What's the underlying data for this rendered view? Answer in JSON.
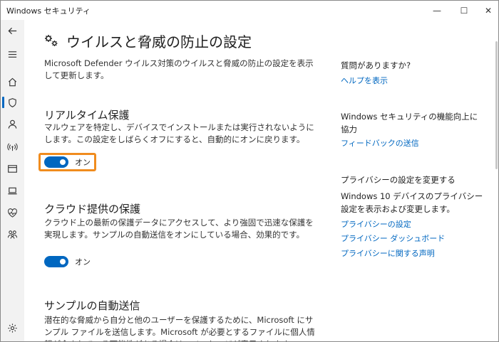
{
  "window": {
    "title": "Windows セキュリティ",
    "minimize_glyph": "—",
    "maximize_glyph": "☐",
    "close_glyph": "✕"
  },
  "rail": {
    "items": [
      {
        "name": "back-icon"
      },
      {
        "name": "menu-icon"
      },
      {
        "name": "home-icon"
      },
      {
        "name": "shield-icon",
        "active": true
      },
      {
        "name": "account-icon"
      },
      {
        "name": "network-icon"
      },
      {
        "name": "app-browser-icon"
      },
      {
        "name": "device-security-icon"
      },
      {
        "name": "health-icon"
      },
      {
        "name": "family-icon"
      },
      {
        "name": "settings-icon"
      }
    ]
  },
  "main": {
    "title": "ウイルスと脅威の防止の設定",
    "intro": "Microsoft Defender ウイルス対策のウイルスと脅威の防止の設定を表示して更新します。",
    "sections": [
      {
        "title": "リアルタイム保護",
        "description": "マルウェアを特定し、デバイスでインストールまたは実行されないようにします。この設定をしばらくオフにすると、自動的にオンに戻ります。",
        "toggle_label": "オン"
      },
      {
        "title": "クラウド提供の保護",
        "description": "クラウド上の最新の保護データにアクセスして、より強固で迅速な保護を実現します。サンプルの自動送信をオンにしている場合、効果的です。",
        "toggle_label": "オン"
      },
      {
        "title": "サンプルの自動送信",
        "description": "潜在的な脅威から自分と他のユーザーを保護するために、Microsoft にサンプル ファイルを送信します。Microsoft が必要とするファイルに個人情報が含まれている可能性がある場合は、メッセージが表示されます。"
      }
    ]
  },
  "side": {
    "question_heading": "質問がありますか?",
    "help_link": "ヘルプを表示",
    "feedback_heading": "Windows セキュリティの機能向上に協力",
    "feedback_link": "フィードバックの送信",
    "privacy_heading": "プライバシーの設定を変更する",
    "privacy_text": "Windows 10 デバイスのプライバシー設定を表示および変更します。",
    "privacy_links": [
      "プライバシーの設定",
      "プライバシー ダッシュボード",
      "プライバシーに関する声明"
    ]
  },
  "colors": {
    "accent": "#0067c0",
    "focus": "#f08c1e"
  }
}
